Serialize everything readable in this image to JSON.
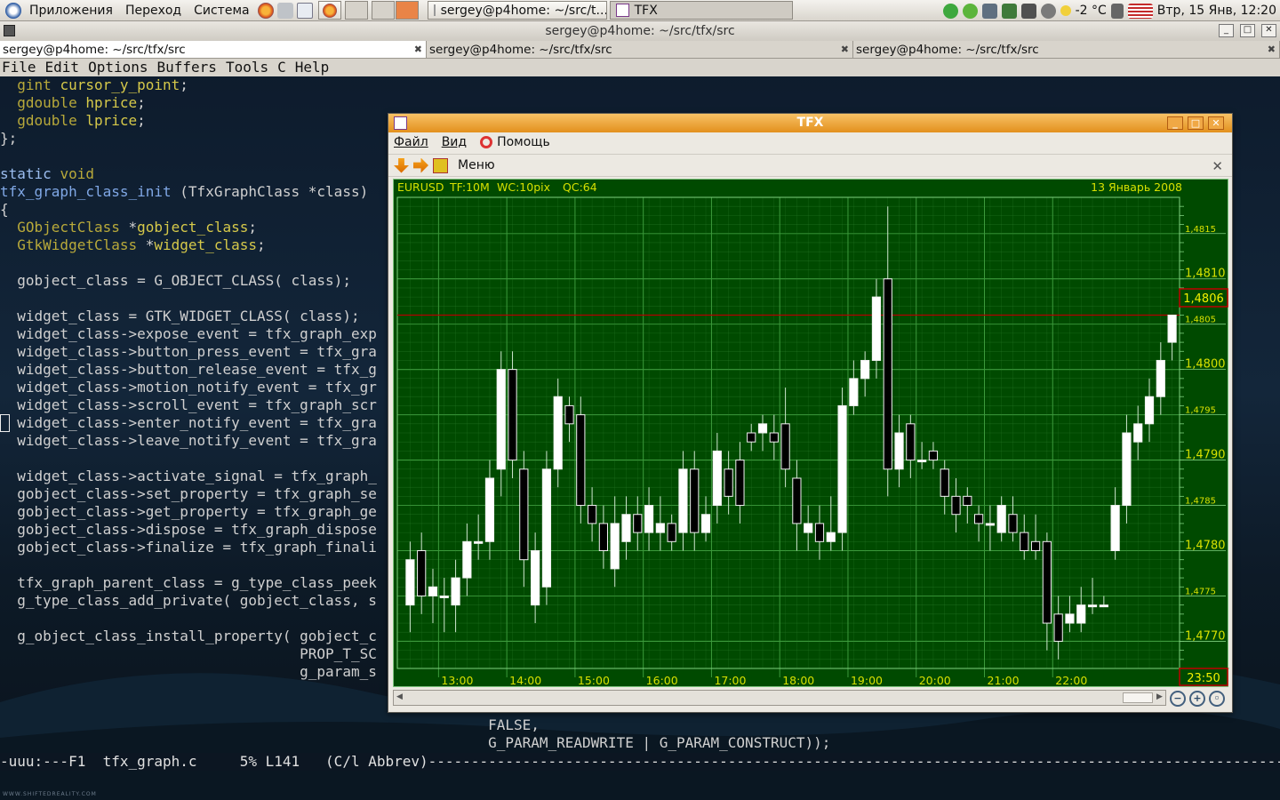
{
  "panel": {
    "menus": [
      "Приложения",
      "Переход",
      "Система"
    ],
    "tasks": [
      {
        "label": "sergey@p4home: ~/src/t..."
      },
      {
        "label": "TFX"
      }
    ],
    "temperature": "-2 °C",
    "clock": "Втр, 15 Янв, 12:20"
  },
  "terminal": {
    "title": "sergey@p4home: ~/src/tfx/src",
    "tabs": [
      "sergey@p4home: ~/src/tfx/src",
      "sergey@p4home: ~/src/tfx/src",
      "sergey@p4home: ~/src/tfx/src"
    ],
    "menubar": [
      "File",
      "Edit",
      "Options",
      "Buffers",
      "Tools",
      "C",
      "Help"
    ],
    "code": [
      [
        {
          "t": "  "
        },
        {
          "c": "ty",
          "t": "gint"
        },
        {
          "t": " "
        },
        {
          "c": "vr",
          "t": "cursor_y_point"
        },
        {
          "t": ";"
        }
      ],
      [
        {
          "t": "  "
        },
        {
          "c": "ty",
          "t": "gdouble"
        },
        {
          "t": " "
        },
        {
          "c": "vr",
          "t": "hprice"
        },
        {
          "t": ";"
        }
      ],
      [
        {
          "t": "  "
        },
        {
          "c": "ty",
          "t": "gdouble"
        },
        {
          "t": " "
        },
        {
          "c": "vr",
          "t": "lprice"
        },
        {
          "t": ";"
        }
      ],
      [
        {
          "t": "};"
        }
      ],
      [
        {
          "t": ""
        }
      ],
      [
        {
          "c": "kw",
          "t": "static"
        },
        {
          "t": " "
        },
        {
          "c": "ty",
          "t": "void"
        }
      ],
      [
        {
          "c": "fn",
          "t": "tfx_graph_class_init"
        },
        {
          "t": " (TfxGraphClass *class)"
        }
      ],
      [
        {
          "t": "{"
        }
      ],
      [
        {
          "t": "  "
        },
        {
          "c": "ty",
          "t": "GObjectClass"
        },
        {
          "t": " *"
        },
        {
          "c": "vr",
          "t": "gobject_class"
        },
        {
          "t": ";"
        }
      ],
      [
        {
          "t": "  "
        },
        {
          "c": "ty",
          "t": "GtkWidgetClass"
        },
        {
          "t": " *"
        },
        {
          "c": "vr",
          "t": "widget_class"
        },
        {
          "t": ";"
        }
      ],
      [
        {
          "t": ""
        }
      ],
      [
        {
          "t": "  gobject_class = G_OBJECT_CLASS( class);"
        }
      ],
      [
        {
          "t": ""
        }
      ],
      [
        {
          "t": "  widget_class = GTK_WIDGET_CLASS( class);"
        }
      ],
      [
        {
          "t": "  widget_class->expose_event = tfx_graph_exp"
        }
      ],
      [
        {
          "t": "  widget_class->button_press_event = tfx_gra"
        }
      ],
      [
        {
          "t": "  widget_class->button_release_event = tfx_g"
        }
      ],
      [
        {
          "t": "  widget_class->motion_notify_event = tfx_gr"
        }
      ],
      [
        {
          "t": "  widget_class->scroll_event = tfx_graph_scr"
        }
      ],
      [
        {
          "t": "  widget_class->enter_notify_event = tfx_gra"
        }
      ],
      [
        {
          "t": "  widget_class->leave_notify_event = tfx_gra"
        }
      ],
      [
        {
          "t": ""
        }
      ],
      [
        {
          "t": "  widget_class->activate_signal = tfx_graph_"
        }
      ],
      [
        {
          "t": "  gobject_class->set_property = tfx_graph_se"
        }
      ],
      [
        {
          "t": "  gobject_class->get_property = tfx_graph_ge"
        }
      ],
      [
        {
          "t": "  gobject_class->dispose = tfx_graph_dispose"
        }
      ],
      [
        {
          "t": "  gobject_class->finalize = tfx_graph_finali"
        }
      ],
      [
        {
          "t": ""
        }
      ],
      [
        {
          "t": "  tfx_graph_parent_class = g_type_class_peek"
        }
      ],
      [
        {
          "t": "  g_type_class_add_private( gobject_class, s"
        }
      ],
      [
        {
          "t": ""
        }
      ],
      [
        {
          "t": "  g_object_class_install_property( gobject_c"
        }
      ],
      [
        {
          "t": "                                   PROP_T_SC"
        }
      ],
      [
        {
          "t": "                                   g_param_s"
        }
      ],
      [
        {
          "t": ""
        }
      ],
      [
        {
          "t": ""
        }
      ],
      [
        {
          "t": "                                                         FALSE,"
        }
      ],
      [
        {
          "t": "                                                         G_PARAM_READWRITE | G_PARAM_CONSTRUCT));"
        }
      ]
    ],
    "modeline": "-uuu:---F1  tfx_graph.c     5% L141   (C/l Abbrev)------------------------------------------------------------------------------------------------------------------------",
    "watermark": "WWW.SHIFTEDREALITY.COM"
  },
  "tfx": {
    "title": "TFX",
    "menu": [
      "Файл",
      "Вид",
      "Помощь"
    ],
    "toolbar_label": "Меню",
    "header": {
      "symbol": "EURUSD",
      "timeframe": "TF:10M",
      "wc": "WC:10pix",
      "qc": "QC:64",
      "date": "13 Январь 2008"
    },
    "current_price": "1,4806",
    "current_time": "23:50"
  },
  "chart_data": {
    "type": "candlestick",
    "ylim": [
      1.4767,
      1.4819
    ],
    "y_ticks_major": [
      "1,4810",
      "1,4800",
      "1,4790",
      "1,4780",
      "1,4770"
    ],
    "y_ticks_minor": [
      "1,4815",
      "1,4805",
      "1,4795",
      "1,4785",
      "1,4775"
    ],
    "x_ticks": [
      "13:00",
      "14:00",
      "15:00",
      "16:00",
      "17:00",
      "18:00",
      "19:00",
      "20:00",
      "21:00",
      "22:00"
    ],
    "current_price": 1.4806,
    "candles": [
      {
        "o": 1.4774,
        "c": 1.4779,
        "h": 1.4781,
        "l": 1.4771
      },
      {
        "o": 1.478,
        "c": 1.4775,
        "h": 1.4782,
        "l": 1.4773
      },
      {
        "o": 1.4775,
        "c": 1.4776,
        "h": 1.4778,
        "l": 1.4772
      },
      {
        "o": 1.4775,
        "c": 1.4775,
        "h": 1.4777,
        "l": 1.4771
      },
      {
        "o": 1.4774,
        "c": 1.4777,
        "h": 1.4779,
        "l": 1.4771
      },
      {
        "o": 1.4777,
        "c": 1.4781,
        "h": 1.4783,
        "l": 1.4775
      },
      {
        "o": 1.4781,
        "c": 1.4781,
        "h": 1.4784,
        "l": 1.4779
      },
      {
        "o": 1.4781,
        "c": 1.4788,
        "h": 1.479,
        "l": 1.4779
      },
      {
        "o": 1.4789,
        "c": 1.48,
        "h": 1.4802,
        "l": 1.4786
      },
      {
        "o": 1.48,
        "c": 1.479,
        "h": 1.4802,
        "l": 1.4788
      },
      {
        "o": 1.4789,
        "c": 1.4779,
        "h": 1.4791,
        "l": 1.4776
      },
      {
        "o": 1.4774,
        "c": 1.478,
        "h": 1.4782,
        "l": 1.4772
      },
      {
        "o": 1.4776,
        "c": 1.4789,
        "h": 1.4791,
        "l": 1.4774
      },
      {
        "o": 1.4789,
        "c": 1.4797,
        "h": 1.4799,
        "l": 1.4787
      },
      {
        "o": 1.4796,
        "c": 1.4794,
        "h": 1.4797,
        "l": 1.4792
      },
      {
        "o": 1.4795,
        "c": 1.4785,
        "h": 1.4797,
        "l": 1.4783
      },
      {
        "o": 1.4785,
        "c": 1.4783,
        "h": 1.4787,
        "l": 1.4781
      },
      {
        "o": 1.4783,
        "c": 1.478,
        "h": 1.4785,
        "l": 1.4778
      },
      {
        "o": 1.4778,
        "c": 1.4783,
        "h": 1.4786,
        "l": 1.4776
      },
      {
        "o": 1.4781,
        "c": 1.4784,
        "h": 1.4786,
        "l": 1.4779
      },
      {
        "o": 1.4784,
        "c": 1.4782,
        "h": 1.4786,
        "l": 1.478
      },
      {
        "o": 1.4782,
        "c": 1.4785,
        "h": 1.4787,
        "l": 1.478
      },
      {
        "o": 1.4782,
        "c": 1.4783,
        "h": 1.4786,
        "l": 1.478
      },
      {
        "o": 1.4783,
        "c": 1.4781,
        "h": 1.4784,
        "l": 1.478
      },
      {
        "o": 1.4782,
        "c": 1.4789,
        "h": 1.4791,
        "l": 1.478
      },
      {
        "o": 1.4789,
        "c": 1.4782,
        "h": 1.4791,
        "l": 1.478
      },
      {
        "o": 1.4782,
        "c": 1.4784,
        "h": 1.4786,
        "l": 1.4781
      },
      {
        "o": 1.4785,
        "c": 1.4791,
        "h": 1.4793,
        "l": 1.4783
      },
      {
        "o": 1.4789,
        "c": 1.4786,
        "h": 1.4791,
        "l": 1.4784
      },
      {
        "o": 1.479,
        "c": 1.4785,
        "h": 1.4792,
        "l": 1.4783
      },
      {
        "o": 1.4793,
        "c": 1.4792,
        "h": 1.4794,
        "l": 1.4791
      },
      {
        "o": 1.4793,
        "c": 1.4794,
        "h": 1.4795,
        "l": 1.4791
      },
      {
        "o": 1.4793,
        "c": 1.4792,
        "h": 1.4795,
        "l": 1.479
      },
      {
        "o": 1.4794,
        "c": 1.4789,
        "h": 1.4798,
        "l": 1.4787
      },
      {
        "o": 1.4788,
        "c": 1.4783,
        "h": 1.479,
        "l": 1.478
      },
      {
        "o": 1.4782,
        "c": 1.4783,
        "h": 1.4785,
        "l": 1.478
      },
      {
        "o": 1.4783,
        "c": 1.4781,
        "h": 1.4785,
        "l": 1.4779
      },
      {
        "o": 1.4781,
        "c": 1.4782,
        "h": 1.4786,
        "l": 1.478
      },
      {
        "o": 1.4782,
        "c": 1.4796,
        "h": 1.4798,
        "l": 1.478
      },
      {
        "o": 1.4796,
        "c": 1.4799,
        "h": 1.4801,
        "l": 1.4795
      },
      {
        "o": 1.4799,
        "c": 1.4801,
        "h": 1.4802,
        "l": 1.4797
      },
      {
        "o": 1.4801,
        "c": 1.4808,
        "h": 1.481,
        "l": 1.4799
      },
      {
        "o": 1.481,
        "c": 1.4789,
        "h": 1.4818,
        "l": 1.4786
      },
      {
        "o": 1.4789,
        "c": 1.4793,
        "h": 1.4795,
        "l": 1.4787
      },
      {
        "o": 1.4794,
        "c": 1.479,
        "h": 1.4795,
        "l": 1.4788
      },
      {
        "o": 1.479,
        "c": 1.479,
        "h": 1.4792,
        "l": 1.4789
      },
      {
        "o": 1.4791,
        "c": 1.479,
        "h": 1.4792,
        "l": 1.4789
      },
      {
        "o": 1.4789,
        "c": 1.4786,
        "h": 1.479,
        "l": 1.4784
      },
      {
        "o": 1.4786,
        "c": 1.4784,
        "h": 1.4788,
        "l": 1.4782
      },
      {
        "o": 1.4786,
        "c": 1.4785,
        "h": 1.4787,
        "l": 1.4783
      },
      {
        "o": 1.4784,
        "c": 1.4783,
        "h": 1.4785,
        "l": 1.4781
      },
      {
        "o": 1.4783,
        "c": 1.4783,
        "h": 1.4785,
        "l": 1.478
      },
      {
        "o": 1.4782,
        "c": 1.4785,
        "h": 1.4786,
        "l": 1.4781
      },
      {
        "o": 1.4784,
        "c": 1.4782,
        "h": 1.4786,
        "l": 1.4781
      },
      {
        "o": 1.4782,
        "c": 1.478,
        "h": 1.4784,
        "l": 1.4779
      },
      {
        "o": 1.4781,
        "c": 1.478,
        "h": 1.4784,
        "l": 1.4779
      },
      {
        "o": 1.4781,
        "c": 1.4772,
        "h": 1.4782,
        "l": 1.4769
      },
      {
        "o": 1.4773,
        "c": 1.477,
        "h": 1.4775,
        "l": 1.4768
      },
      {
        "o": 1.4772,
        "c": 1.4773,
        "h": 1.4775,
        "l": 1.4771
      },
      {
        "o": 1.4772,
        "c": 1.4774,
        "h": 1.4776,
        "l": 1.4771
      },
      {
        "o": 1.4774,
        "c": 1.4774,
        "h": 1.4777,
        "l": 1.4773
      },
      {
        "o": 1.4774,
        "c": 1.4774,
        "h": 1.4775,
        "l": 1.4774
      },
      {
        "o": 1.478,
        "c": 1.4785,
        "h": 1.4787,
        "l": 1.4779
      },
      {
        "o": 1.4785,
        "c": 1.4793,
        "h": 1.4795,
        "l": 1.4783
      },
      {
        "o": 1.4792,
        "c": 1.4794,
        "h": 1.4796,
        "l": 1.479
      },
      {
        "o": 1.4794,
        "c": 1.4797,
        "h": 1.4799,
        "l": 1.4792
      },
      {
        "o": 1.4797,
        "c": 1.4801,
        "h": 1.4803,
        "l": 1.4795
      },
      {
        "o": 1.4803,
        "c": 1.4806,
        "h": 1.4806,
        "l": 1.4801
      }
    ]
  },
  "colors": {
    "chart_bg": "#004a00",
    "grid": "#2f7f2f",
    "bull": "#ffffff",
    "bear": "#000000",
    "text": "#d7e000",
    "price_line": "#b30000"
  }
}
